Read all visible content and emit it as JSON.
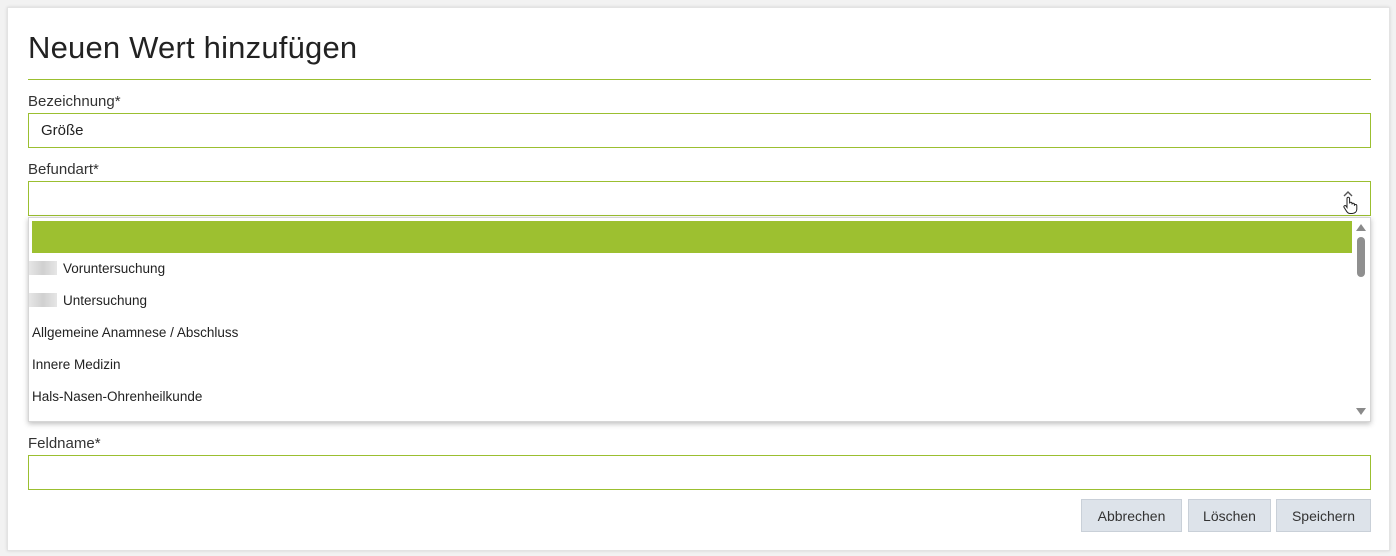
{
  "dialog": {
    "title": "Neuen Wert hinzufügen",
    "accent_color": "#9bbf30"
  },
  "fields": {
    "bezeichnung": {
      "label": "Bezeichnung*",
      "value": "Größe"
    },
    "befundart": {
      "label": "Befundart*",
      "value": "",
      "caret_icon": "chevron-up-icon"
    },
    "feldname": {
      "label": "Feldname*",
      "value": ""
    }
  },
  "dropdown": {
    "selected_color": "#9dc030",
    "options": [
      {
        "label": "",
        "selected": true
      },
      {
        "label": "Voruntersuchung",
        "icon": "redacted-icon"
      },
      {
        "label": "Untersuchung",
        "icon": "redacted-icon"
      },
      {
        "label": "Allgemeine Anamnese / Abschluss"
      },
      {
        "label": "Innere Medizin"
      },
      {
        "label": "Hals-Nasen-Ohrenheilkunde"
      }
    ]
  },
  "buttons": {
    "cancel": "Abbrechen",
    "delete": "Löschen",
    "save": "Speichern"
  }
}
